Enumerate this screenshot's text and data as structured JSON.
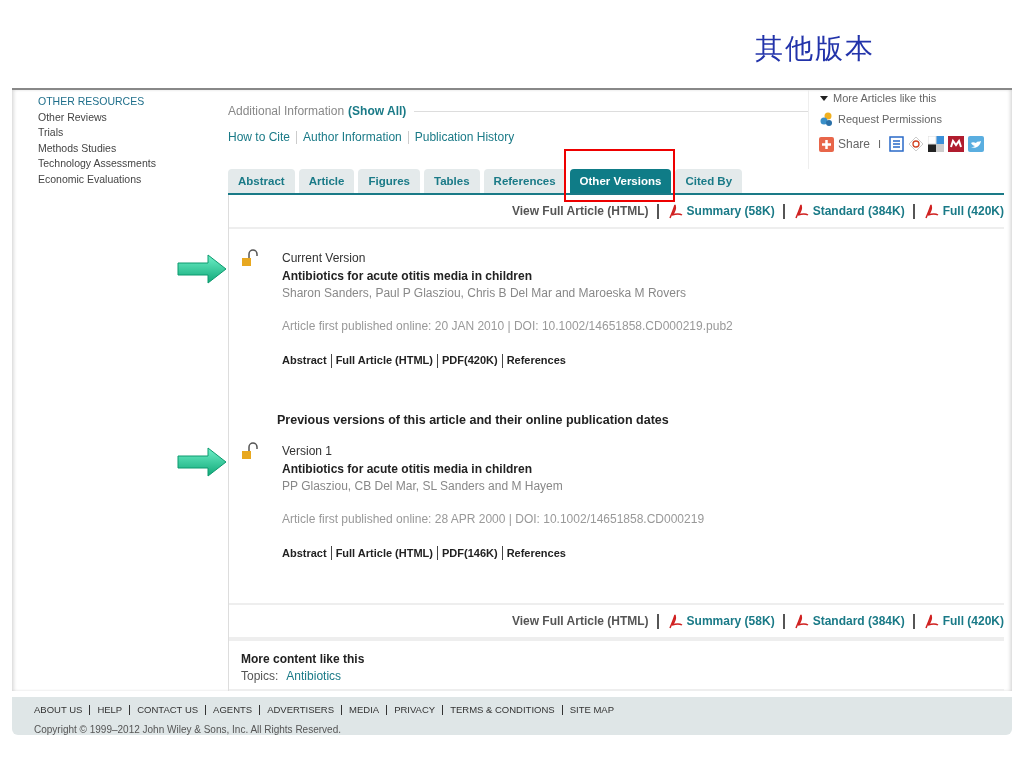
{
  "slide_title": "其他版本",
  "sidebar": {
    "heading": "OTHER RESOURCES",
    "items": [
      "Other Reviews",
      "Trials",
      "Methods Studies",
      "Technology Assessments",
      "Economic Evaluations"
    ]
  },
  "additional_info": {
    "label": "Additional Information",
    "show_all": "(Show All)",
    "links": [
      "How to Cite",
      "Author Information",
      "Publication History"
    ]
  },
  "right_panel": {
    "more_articles": "More Articles like this",
    "request_permissions": "Request Permissions",
    "share": "Share",
    "share_separator": "I"
  },
  "tabs": [
    {
      "label": "Abstract",
      "selected": false,
      "highlighted": false
    },
    {
      "label": "Article",
      "selected": false,
      "highlighted": false
    },
    {
      "label": "Figures",
      "selected": false,
      "highlighted": false
    },
    {
      "label": "Tables",
      "selected": false,
      "highlighted": false
    },
    {
      "label": "References",
      "selected": false,
      "highlighted": false
    },
    {
      "label": "Other Versions",
      "selected": true,
      "highlighted": true
    },
    {
      "label": "Cited By",
      "selected": false,
      "highlighted": false
    }
  ],
  "top_links": [
    {
      "kind": "html",
      "label": "View Full Article (HTML)"
    },
    {
      "kind": "pdf",
      "label": "Summary (58K)"
    },
    {
      "kind": "pdf",
      "label": "Standard (384K)"
    },
    {
      "kind": "pdf",
      "label": "Full (420K)"
    }
  ],
  "current_version": {
    "pointer_arrow": true,
    "label": "Current Version",
    "title": "Antibiotics for acute otitis media in children",
    "authors": "Sharon Sanders, Paul P Glasziou, Chris B Del Mar and Maroeska M Rovers",
    "published": "Article first published online: 20 JAN 2010 | DOI: 10.1002/14651858.CD000219.pub2",
    "links": [
      "Abstract",
      "Full Article (HTML)",
      "PDF(420K)",
      "References"
    ]
  },
  "previous_heading": "Previous versions of this article and their online publication dates",
  "previous_versions": [
    {
      "pointer_arrow": true,
      "label": "Version 1",
      "title": "Antibiotics for acute otitis media in children",
      "authors": "PP Glasziou, CB Del Mar, SL Sanders and M Hayem",
      "published": "Article first published online: 28 APR 2000 | DOI: 10.1002/14651858.CD000219",
      "links": [
        "Abstract",
        "Full Article (HTML)",
        "PDF(146K)",
        "References"
      ]
    }
  ],
  "bottom_links": [
    {
      "kind": "html",
      "label": "View Full Article (HTML)"
    },
    {
      "kind": "pdf",
      "label": "Summary (58K)"
    },
    {
      "kind": "pdf",
      "label": "Standard (384K)"
    },
    {
      "kind": "pdf",
      "label": "Full (420K)"
    }
  ],
  "more_content": {
    "title": "More content like this",
    "topics_label": "Topics:",
    "topic": "Antibiotics"
  },
  "footer": {
    "links": [
      "ABOUT US",
      "HELP",
      "CONTACT US",
      "AGENTS",
      "ADVERTISERS",
      "MEDIA",
      "PRIVACY",
      "TERMS & CONDITIONS",
      "SITE MAP"
    ],
    "copyright": "Copyright © 1999–2012 John Wiley & Sons, Inc. All Rights Reserved."
  }
}
